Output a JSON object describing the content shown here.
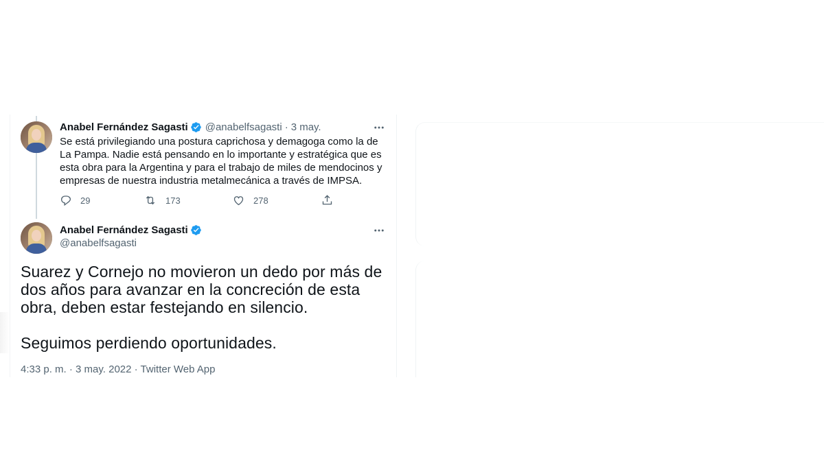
{
  "tweet_reply": {
    "author_name": "Anabel Fernández Sagasti",
    "handle": "@anabelfsagasti",
    "separator": "·",
    "date": "3 may.",
    "text": "Se está privilegiando una postura caprichosa y demagoga como la de La Pampa. Nadie está pensando en lo importante y estratégica que es esta obra para la Argentina y para el trabajo de miles de mendocinos y empresas de nuestra industria metalmecánica a través de IMPSA.",
    "replies": "29",
    "retweets": "173",
    "likes": "278"
  },
  "tweet_main": {
    "author_name": "Anabel Fernández Sagasti",
    "handle": "@anabelfsagasti",
    "paragraph1": "Suarez y Cornejo no movieron un dedo por más de dos años para avanzar en la concreción de esta obra, deben estar festejando en silencio.",
    "paragraph2": "Seguimos perdiendo oportunidades.",
    "meta": "4:33 p. m. · 3 may. 2022 · Twitter Web App"
  },
  "icons": {
    "verified": "verified-badge-icon",
    "more": "more-options-icon",
    "reply": "reply-icon",
    "retweet": "retweet-icon",
    "like": "heart-icon",
    "share": "share-icon"
  },
  "colors": {
    "verified_blue": "#1d9bf0",
    "text_primary": "#0f1419",
    "text_secondary": "#536471",
    "border": "#eff3f4"
  }
}
